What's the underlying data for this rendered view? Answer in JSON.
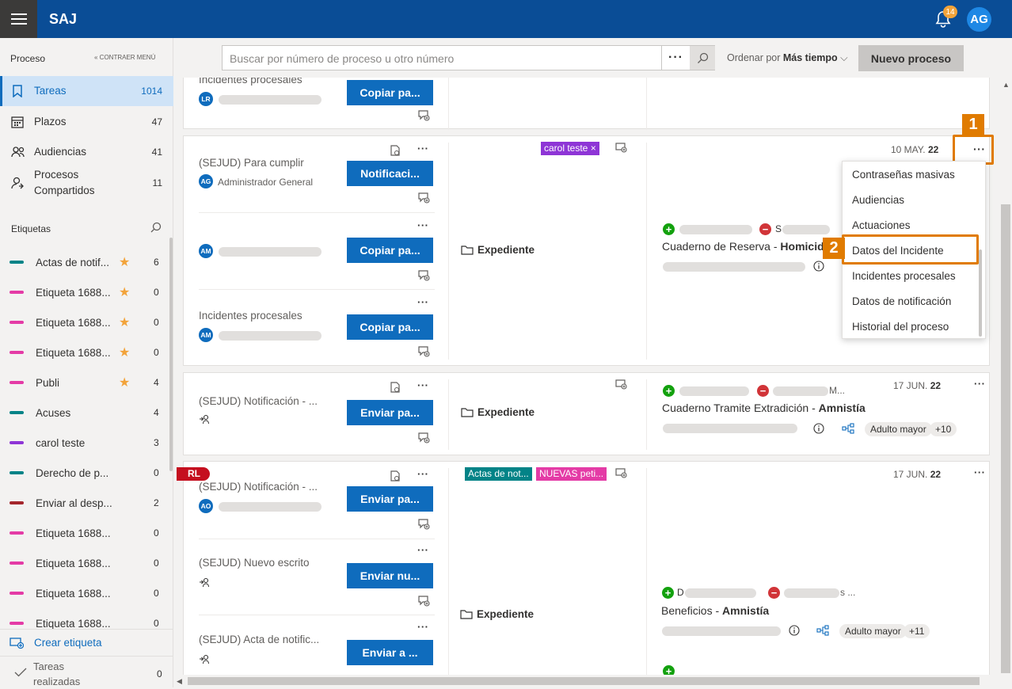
{
  "app": {
    "brand": "SAJ",
    "notifications": "14",
    "user_initials": "AG"
  },
  "sidebar": {
    "section_title": "Proceso",
    "collapse_label": "« CONTRAER MENÚ",
    "nav": [
      {
        "label": "Tareas",
        "count": "1014"
      },
      {
        "label": "Plazos",
        "count": "47"
      },
      {
        "label": "Audiencias",
        "count": "41"
      },
      {
        "label": "Procesos Compartidos",
        "count": "11"
      }
    ],
    "tags_title": "Etiquetas",
    "tags": [
      {
        "label": "Actas de notif...",
        "count": "6",
        "color": "#038387",
        "star": true
      },
      {
        "label": "Etiqueta 1688...",
        "count": "0",
        "color": "#e43ba6",
        "star": true
      },
      {
        "label": "Etiqueta 1688...",
        "count": "0",
        "color": "#e43ba6",
        "star": true
      },
      {
        "label": "Etiqueta 1688...",
        "count": "0",
        "color": "#e43ba6",
        "star": true
      },
      {
        "label": "Publi",
        "count": "4",
        "color": "#e43ba6",
        "star": true
      },
      {
        "label": "Acuses",
        "count": "4",
        "color": "#038387",
        "star": false
      },
      {
        "label": "carol teste",
        "count": "3",
        "color": "#8e35d6",
        "star": false
      },
      {
        "label": "Derecho de p...",
        "count": "0",
        "color": "#038387",
        "star": false
      },
      {
        "label": "Enviar al desp...",
        "count": "2",
        "color": "#a4262c",
        "star": false
      },
      {
        "label": "Etiqueta 1688...",
        "count": "0",
        "color": "#e43ba6",
        "star": false
      },
      {
        "label": "Etiqueta 1688...",
        "count": "0",
        "color": "#e43ba6",
        "star": false
      },
      {
        "label": "Etiqueta 1688...",
        "count": "0",
        "color": "#e43ba6",
        "star": false
      },
      {
        "label": "Etiqueta 1688...",
        "count": "0",
        "color": "#e43ba6",
        "star": false
      }
    ],
    "create_tag": "Crear etiqueta",
    "done_tasks": {
      "label": "Tareas realizadas",
      "count": "0"
    }
  },
  "toolbar": {
    "search_placeholder": "Buscar por número de proceso u otro número",
    "sort_prefix": "Ordenar por",
    "sort_value": "Más tiempo",
    "new_process": "Nuevo proceso"
  },
  "cards": {
    "c0": {
      "task_title": "Incidentes procesales",
      "initials": "LR",
      "button": "Copiar pa..."
    },
    "c1": {
      "tasks": [
        {
          "title": "(SEJUD) Para cumplir",
          "initials": "AG",
          "user": "Administrador General",
          "button": "Notificaci..."
        },
        {
          "initials": "AM",
          "button": "Copiar pa..."
        },
        {
          "title": "Incidentes procesales",
          "initials": "AM",
          "button": "Copiar pa..."
        }
      ],
      "chip": "carol teste",
      "folder": "Expediente",
      "date": "10 MAY.",
      "date_year": "22",
      "party_s": "S",
      "case": "Cuaderno de Reserva - ",
      "case_bold": "Homicid"
    },
    "c2": {
      "task_title": "(SEJUD) Notificación - ...",
      "button": "Enviar pa...",
      "folder": "Expediente",
      "date": "17 JUN.",
      "date_year": "22",
      "party_m": "M...",
      "case": "Cuaderno Tramite Extradición - ",
      "case_bold": "Amnistía",
      "pill": "Adulto mayor",
      "more": "+10"
    },
    "c3": {
      "ribbon": "RL",
      "tasks": [
        {
          "title": "(SEJUD) Notificación - ...",
          "initials": "AO",
          "button": "Enviar pa..."
        },
        {
          "title": "(SEJUD) Nuevo escrito",
          "button": "Enviar nu..."
        },
        {
          "title": "(SEJUD) Acta de notific...",
          "button": "Enviar a ..."
        }
      ],
      "chip1": "Actas de not...",
      "chip2": "NUEVAS peti...",
      "folder": "Expediente",
      "date": "17 JUN.",
      "date_year": "22",
      "party_d": "D",
      "party_s": "s ...",
      "case": "Beneficios - ",
      "case_bold": "Amnistía",
      "pill": "Adulto mayor",
      "more": "+11"
    }
  },
  "menu": {
    "items": [
      "Contraseñas masivas",
      "Audiencias",
      "Actuaciones",
      "Datos del Incidente",
      "Incidentes procesales",
      "Datos de notificación",
      "Historial del proceso"
    ]
  },
  "callouts": [
    "1",
    "2"
  ],
  "colors": {
    "header": "#0a4d96",
    "primary": "#0f6cbd",
    "highlight": "#e07b00",
    "ribbon": "#c50f1f"
  }
}
